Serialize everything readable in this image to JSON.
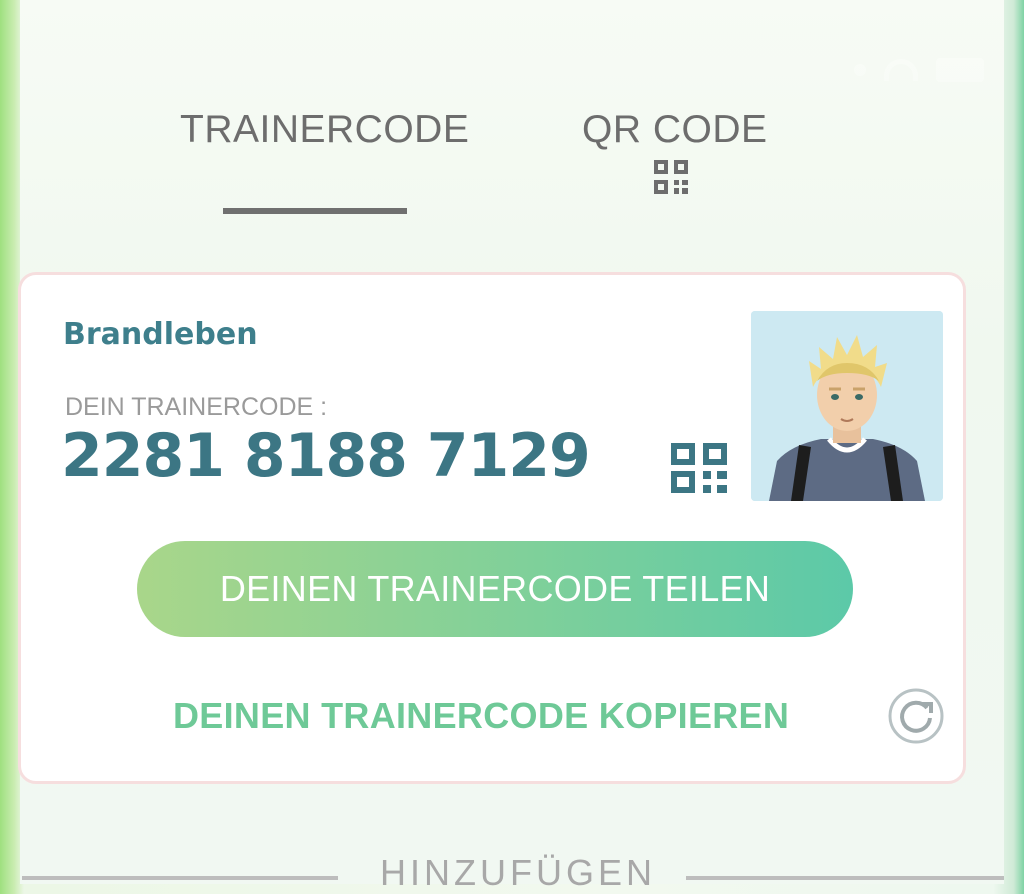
{
  "tabs": {
    "trainercode": "TRAINERCODE",
    "qr_code": "QR CODE",
    "active": "trainercode"
  },
  "card": {
    "trainer_name": "Brandleben",
    "code_label": "DEIN TRAINERCODE :",
    "code_value": "2281 8188 7129",
    "share_button": "DEINEN TRAINERCODE TEILEN",
    "copy_link": "DEINEN TRAINERCODE KOPIEREN"
  },
  "section": {
    "title": "HINZUFÜGEN"
  },
  "icons": {
    "qr": "qr-code-icon",
    "refresh": "refresh-icon",
    "avatar": "trainer-avatar"
  },
  "colors": {
    "accent_teal": "#3c7684",
    "name_teal": "#3e7f8c",
    "copy_green": "#6ec997",
    "button_gradient_start": "#a9d68a",
    "button_gradient_end": "#5cc9a8",
    "tab_text": "#6d6d6d"
  }
}
